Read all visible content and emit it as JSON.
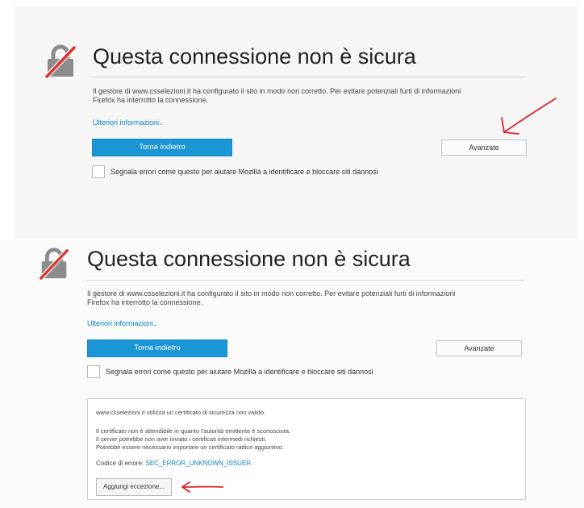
{
  "top": {
    "title": "Questa connessione non è sicura",
    "description_line1": "Il gestore di www.csselezioni.it ha configurato il sito in modo non corretto. Per evitare potenziali furti di informazioni",
    "description_line2": "Firefox ha interrotto la connessione.",
    "more_info": "Ulteriori informazioni..",
    "back_button": "Torna indietro",
    "advanced_button": "Avanzate",
    "report_label": "Segnala errori come questo per aiutare Mozilla a identificare e bloccare siti dannosi"
  },
  "bottom": {
    "title": "Questa connessione non è sicura",
    "description_line1": "Il gestore di www.csselezioni.it ha configurato il sito in modo non corretto. Per evitare potenziali furti di informazioni",
    "description_line2": "Firefox ha interrotto la connessione.",
    "more_info": "Ulteriori informazioni..",
    "back_button": "Torna indietro",
    "advanced_button": "Avanzate",
    "report_label": "Segnala errori come questo per aiutare Mozilla a identificare e bloccare siti dannosi",
    "advanced_panel": {
      "line1": "www.csselezioni.it utilizza un certificato di sicurezza non valido.",
      "line2": "Il certificato non è attendibile in quanto l'autorità emittente è sconosciuta.",
      "line3": "Il server potrebbe non aver inviato i certificati intermedi richiesti.",
      "line4": "Potrebbe essere necessario importare un certificato radice aggiuntivo.",
      "error_code_label": "Codice di errore:",
      "error_code": "SEC_ERROR_UNKNOWN_ISSUER",
      "add_exception_button": "Aggiungi eccezione..."
    }
  },
  "colors": {
    "accent_blue": "#1a96d6",
    "link_blue": "#0a84c0",
    "annotation_red": "#d8262b",
    "lock_gray": "#8c8c8c",
    "slash_red": "#d9342b"
  },
  "icons": {
    "warning": "broken-lock-icon",
    "annotation": "red-arrow-annotation"
  }
}
